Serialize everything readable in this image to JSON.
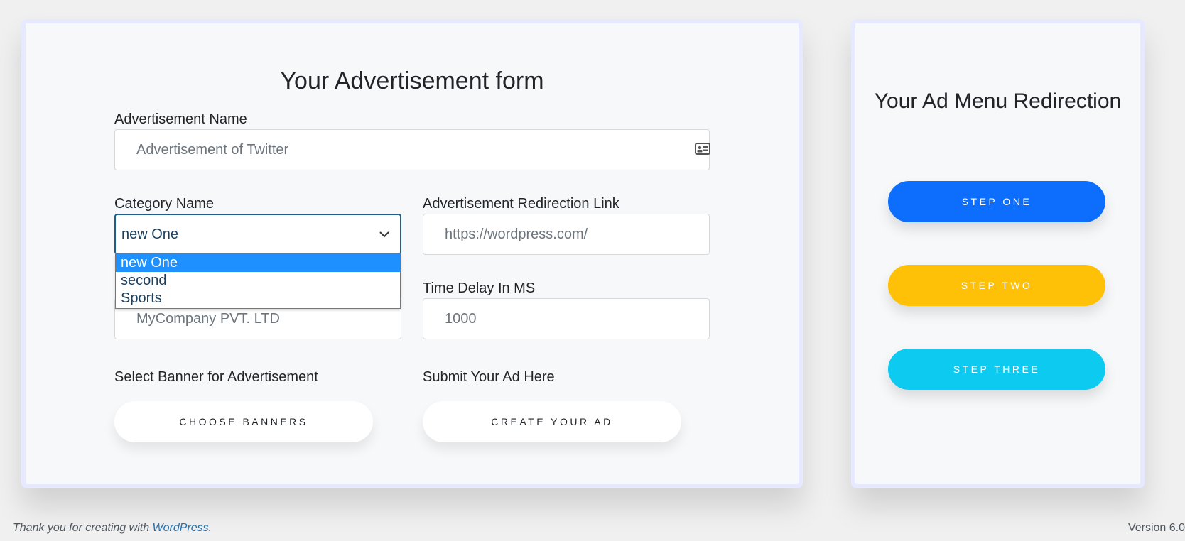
{
  "form": {
    "title": "Your Advertisement form",
    "ad_name": {
      "label": "Advertisement Name",
      "placeholder": "Advertisement of Twitter",
      "icon": "id-card-icon"
    },
    "category": {
      "label": "Category Name",
      "selected": "new One",
      "options": [
        "new One",
        "second",
        "Sports"
      ]
    },
    "redirect_link": {
      "label": "Advertisement Redirection Link",
      "placeholder": "https://wordpress.com/"
    },
    "company": {
      "placeholder": "MyCompany PVT. LTD"
    },
    "time_delay": {
      "label": "Time Delay In MS",
      "placeholder": "1000"
    },
    "banner": {
      "label": "Select Banner for Advertisement",
      "button": "Choose Banners"
    },
    "submit": {
      "label": "Submit Your Ad Here",
      "button": "Create Your Ad"
    }
  },
  "side": {
    "title": "Your Ad Menu Redirection",
    "steps": [
      {
        "label": "Step One",
        "color": "#0d6efd"
      },
      {
        "label": "Step Two",
        "color": "#ffc107"
      },
      {
        "label": "Step Three",
        "color": "#0dcaf0"
      }
    ]
  },
  "footer": {
    "thanks_prefix": "Thank you for creating with",
    "link_text": "WordPress",
    "thanks_suffix": ".",
    "version": "Version 6.0"
  }
}
